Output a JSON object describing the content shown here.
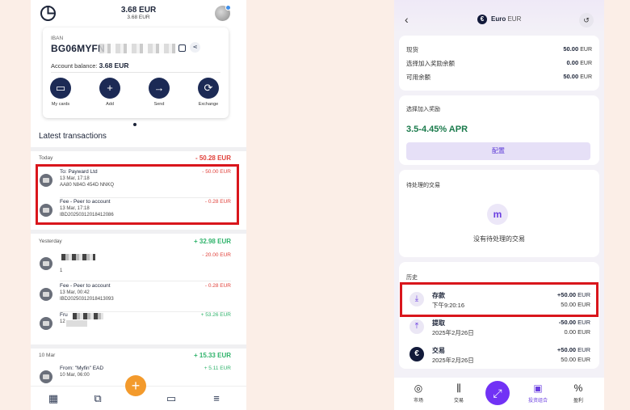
{
  "left": {
    "header": {
      "total": "3.68 EUR",
      "total_sub": "3.68 EUR"
    },
    "card": {
      "label": "IBAN",
      "iban": "BG06MYFN",
      "balance_label": "Account balance:",
      "balance_value": "3.68 EUR",
      "actions": [
        {
          "label": "My cards",
          "icon": "card-icon"
        },
        {
          "label": "Add",
          "icon": "plus-icon"
        },
        {
          "label": "Send",
          "icon": "arrow-right-icon"
        },
        {
          "label": "Exchange",
          "icon": "exchange-icon"
        }
      ]
    },
    "section_title": "Latest transactions",
    "groups": [
      {
        "label": "Today",
        "amount": "- 50.28 EUR",
        "items": [
          {
            "name": "To: Payward Ltd",
            "line2": "13 Mar, 17:18",
            "line3": "AA80 N84G 454D NNKQ",
            "amount": "- 50.00 EUR"
          },
          {
            "name": "Fee - Peer to account",
            "line2": "13 Mar, 17:18",
            "line3": "IBD20250312018412086",
            "amount": "- 0.28 EUR"
          }
        ]
      },
      {
        "label": "Yesterday",
        "amount": "+ 32.98 EUR",
        "items": [
          {
            "name": "",
            "line2": "1",
            "line3": "",
            "amount": "- 20.00 EUR"
          },
          {
            "name": "Fee - Peer to account",
            "line2": "13 Mar, 00:42",
            "line3": "IBD20250312018413093",
            "amount": "- 0.28 EUR"
          },
          {
            "name": "Fru",
            "line2": "12",
            "line3": "",
            "amount": "+ 53.26 EUR"
          }
        ]
      },
      {
        "label": "10 Mar",
        "amount": "+ 15.33 EUR",
        "items": [
          {
            "name": "From: \"Myfin\" EAD",
            "line2": "10 Mar, 06:00",
            "line3": "",
            "amount": "+ 5.11 EUR"
          }
        ]
      }
    ],
    "nav": [
      "grid-icon",
      "chart-icon",
      "plus-icon",
      "card-icon",
      "menu-icon"
    ]
  },
  "right": {
    "header": {
      "title": "Euro",
      "code": "EUR",
      "back": "‹"
    },
    "balances": [
      {
        "label": "现货",
        "value": "50.00",
        "unit": "EUR"
      },
      {
        "label": "选择加入奖励余额",
        "value": "0.00",
        "unit": "EUR"
      },
      {
        "label": "可用余额",
        "value": "50.00",
        "unit": "EUR"
      }
    ],
    "rewards": {
      "label": "选择加入奖励",
      "apr": "3.5-4.45% APR",
      "button": "配置"
    },
    "pending": {
      "label": "待处理的交易",
      "empty": "没有待处理的交易"
    },
    "history": {
      "label": "历史",
      "items": [
        {
          "name": "存款",
          "date": "下午9:20:16",
          "amount": "+50.00",
          "balance": "50.00",
          "unit": "EUR",
          "icon": "download-icon"
        },
        {
          "name": "提取",
          "date": "2025年2月26日",
          "amount": "-50.00",
          "balance": "0.00",
          "unit": "EUR",
          "icon": "upload-icon"
        },
        {
          "name": "交易",
          "date": "2025年2月26日",
          "amount": "+50.00",
          "balance": "50.00",
          "unit": "EUR",
          "icon": "euro-icon"
        }
      ]
    },
    "nav": [
      {
        "label": "市场",
        "icon": "coins-icon"
      },
      {
        "label": "交易",
        "icon": "candles-icon"
      },
      {
        "label": "",
        "icon": "swap-icon"
      },
      {
        "label": "投资组合",
        "icon": "wallet-icon"
      },
      {
        "label": "盈利",
        "icon": "percent-icon"
      }
    ]
  },
  "colors": {
    "negative": "#e0403a",
    "positive": "#2fb36b",
    "highlight": "#d9161c",
    "accent_right": "#7132f5",
    "navy": "#1c2a55"
  }
}
